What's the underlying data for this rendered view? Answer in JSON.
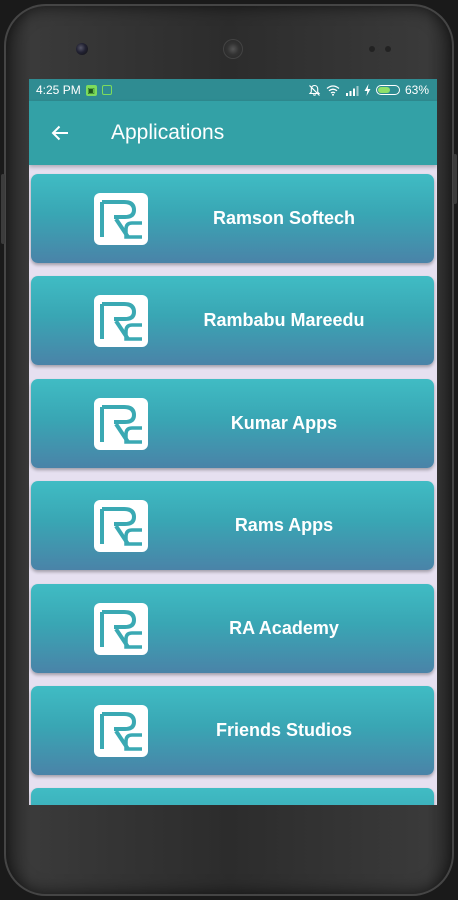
{
  "status_bar": {
    "time": "4:25 PM",
    "battery_text": "63%",
    "battery_level": 0.63,
    "icons": [
      "notification-app-icon",
      "notification-app-outline-icon",
      "mute-bell-icon",
      "wifi-icon",
      "signal-icon",
      "charging-bolt-icon",
      "battery-icon"
    ]
  },
  "app_bar": {
    "title": "Applications",
    "back_icon": "arrow-back-icon"
  },
  "apps": [
    {
      "label": "Ramson Softech"
    },
    {
      "label": "Rambabu Mareedu"
    },
    {
      "label": "Kumar Apps"
    },
    {
      "label": "Rams Apps"
    },
    {
      "label": "RA Academy"
    },
    {
      "label": "Friends Studios"
    },
    {
      "label": ""
    }
  ],
  "colors": {
    "status_bar": "#2f8c92",
    "app_bar": "#33a1a6",
    "card_top": "#40bcc4",
    "card_bottom": "#4a83a8",
    "screen_bg": "#e6e0f0"
  }
}
